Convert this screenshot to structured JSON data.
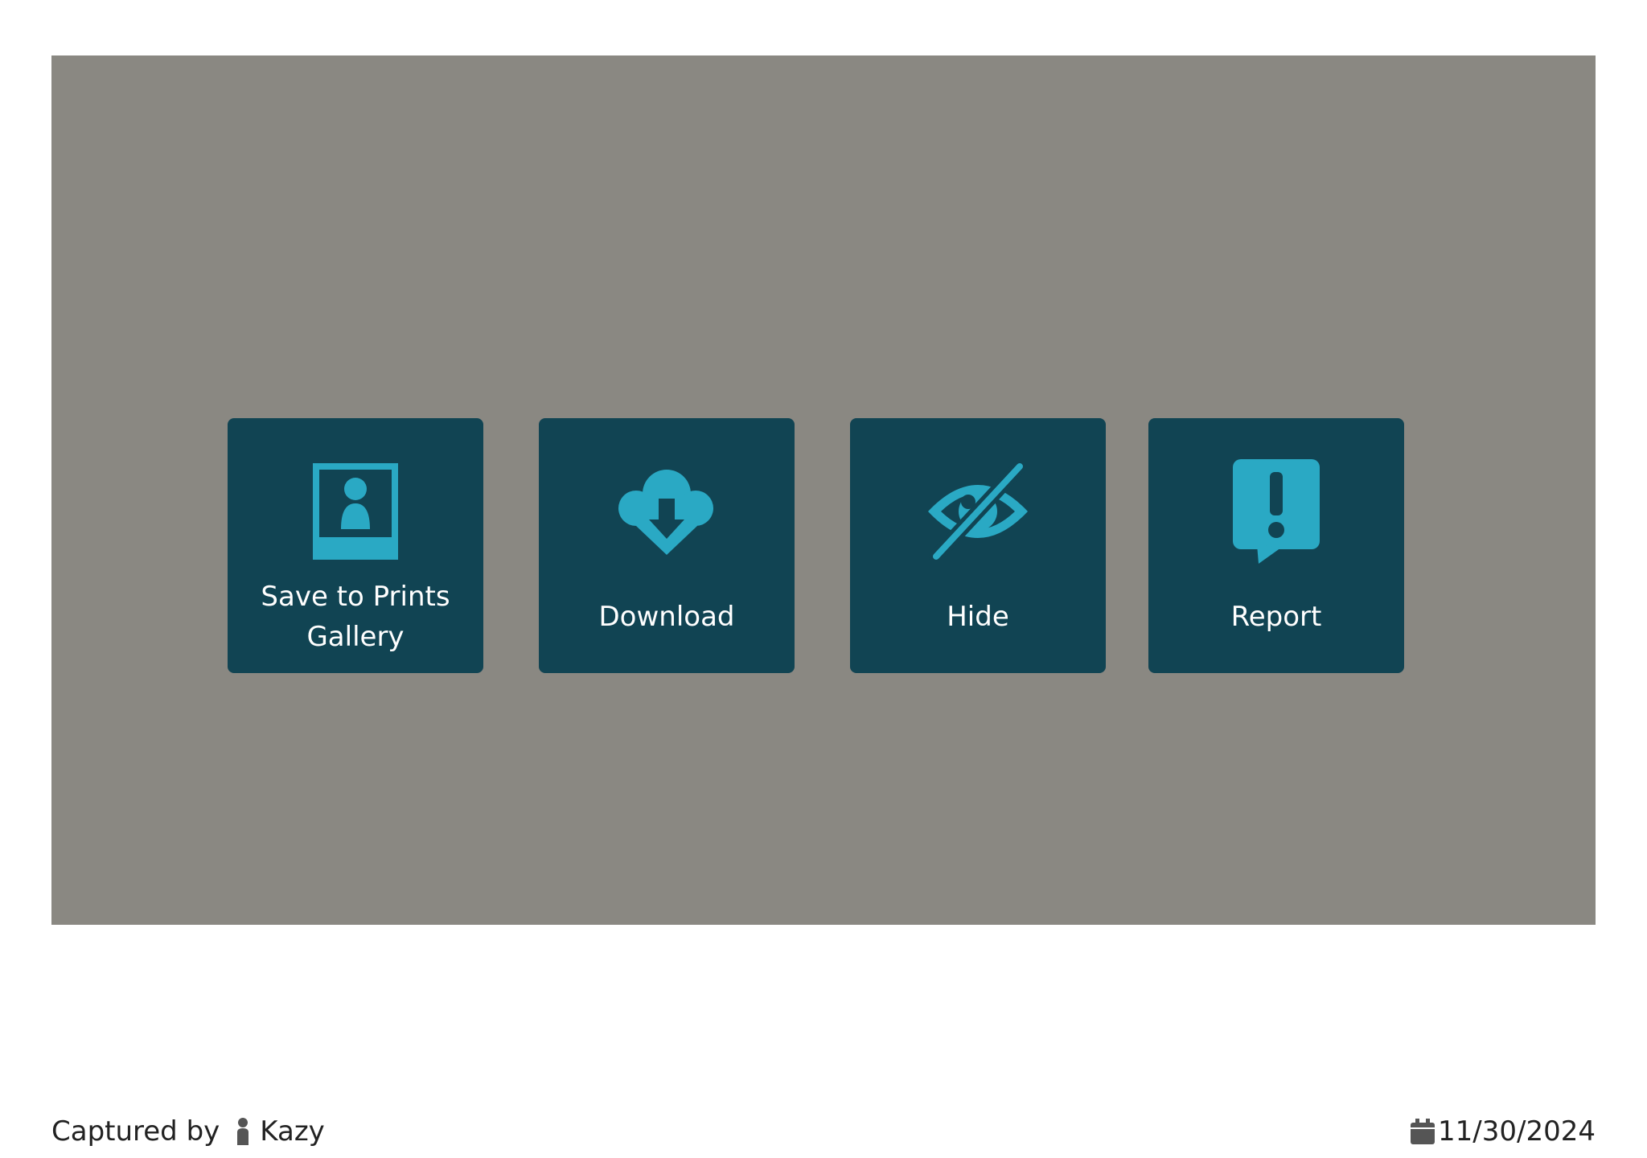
{
  "photo": {
    "background_color": "#8a8882"
  },
  "actions": [
    {
      "label_line1": "Save to Prints",
      "label_line2": "Gallery",
      "icon": "photo-print-icon"
    },
    {
      "label": "Download",
      "icon": "cloud-download-icon"
    },
    {
      "label": "Hide",
      "icon": "eye-slash-icon"
    },
    {
      "label": "Report",
      "icon": "report-alert-icon"
    }
  ],
  "colors": {
    "tile_background": "#114453",
    "icon_accent": "#2aa9c4",
    "tile_text": "#ffffff"
  },
  "footer": {
    "captured_by_label": "Captured by",
    "author": "Kazy",
    "date": "11/30/2024"
  }
}
